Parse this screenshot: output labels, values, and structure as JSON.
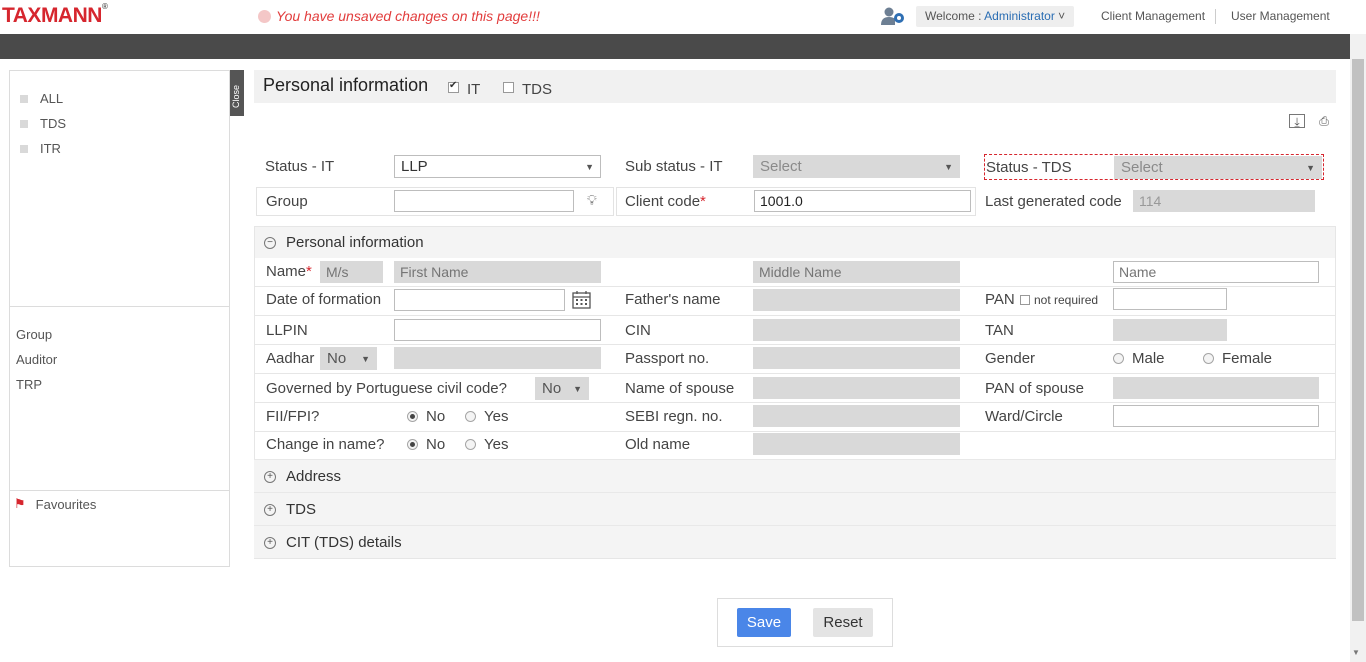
{
  "header": {
    "logo": "TAXMANN",
    "logo_mark": "®",
    "unsaved_message": "You have unsaved changes on this page!!!",
    "welcome_prefix": "Welcome : ",
    "welcome_user": "Administrator",
    "nav": [
      "Client Management",
      "User Management"
    ]
  },
  "sidebar": {
    "filters": [
      "ALL",
      "TDS",
      "ITR"
    ],
    "links": [
      "Group",
      "Auditor",
      "TRP"
    ],
    "favourites": "Favourites",
    "close_label": "Close"
  },
  "title": {
    "text": "Personal information",
    "it_label": "IT",
    "it_checked": true,
    "tds_label": "TDS",
    "tds_checked": false
  },
  "form": {
    "status_it_label": "Status - IT",
    "status_it_value": "LLP",
    "sub_status_label": "Sub status - IT",
    "sub_status_value": "Select",
    "status_tds_label": "Status - TDS",
    "status_tds_value": "Select",
    "group_label": "Group",
    "group_value": "",
    "client_code_label": "Client code",
    "client_code_value": "1001.0",
    "last_code_label": "Last generated code",
    "last_code_value": "114"
  },
  "personal": {
    "section_title": "Personal information",
    "name_label": "Name",
    "prefix_placeholder": "M/s",
    "first_name_placeholder": "First Name",
    "middle_name_placeholder": "Middle Name",
    "last_name_placeholder": "Name",
    "dof_label": "Date of formation",
    "father_label": "Father's name",
    "pan_label": "PAN",
    "pan_not_required": "not required",
    "llpin_label": "LLPIN",
    "cin_label": "CIN",
    "tan_label": "TAN",
    "aadhar_label": "Aadhar",
    "aadhar_value": "No",
    "passport_label": "Passport no.",
    "gender_label": "Gender",
    "gender_options": [
      "Male",
      "Female"
    ],
    "portuguese_label": "Governed by Portuguese civil code?",
    "portuguese_value": "No",
    "spouse_name_label": "Name of spouse",
    "spouse_pan_label": "PAN of spouse",
    "fii_label": "FII/FPI?",
    "yes_no": [
      "No",
      "Yes"
    ],
    "sebi_label": "SEBI regn. no.",
    "ward_label": "Ward/Circle",
    "change_name_label": "Change in name?",
    "old_name_label": "Old name"
  },
  "sections": [
    "Address",
    "TDS",
    "CIT (TDS) details"
  ],
  "actions": {
    "save": "Save",
    "reset": "Reset"
  },
  "colors": {
    "brand": "#d6262e",
    "accent": "#4a86e8",
    "dark_bar": "#4a4a4a"
  }
}
